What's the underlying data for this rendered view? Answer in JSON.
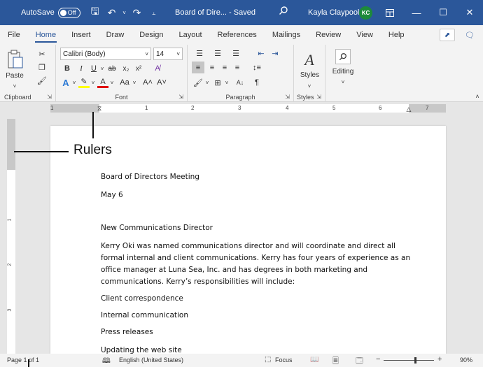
{
  "titlebar": {
    "autosave_label": "AutoSave",
    "autosave_state": "Off",
    "doc_title": "Board of Dire...  -  Saved",
    "user_name": "Kayla Claypool",
    "user_initials": "KC"
  },
  "tabs": [
    "File",
    "Home",
    "Insert",
    "Draw",
    "Design",
    "Layout",
    "References",
    "Mailings",
    "Review",
    "View",
    "Help"
  ],
  "ribbon": {
    "clipboard": {
      "paste_label": "Paste",
      "group_label": "Clipboard"
    },
    "font": {
      "font_name": "Calibri (Body)",
      "font_size": "14",
      "group_label": "Font",
      "bold": "B",
      "italic": "I",
      "underline": "U",
      "grow": "A˄",
      "shrink": "A˅",
      "case": "Aa"
    },
    "paragraph": {
      "group_label": "Paragraph"
    },
    "styles": {
      "styles_label": "Styles",
      "group_label": "Styles"
    },
    "editing": {
      "editing_label": "Editing"
    }
  },
  "ruler": {
    "numbers": [
      "1",
      "1",
      "2",
      "3",
      "4",
      "5",
      "6",
      "7"
    ],
    "vnumbers": [
      "1",
      "2",
      "3"
    ]
  },
  "document": {
    "lines": [
      "Board of Directors Meeting",
      "May 6",
      "New Communications Director",
      "Kerry Oki was named communications director and will coordinate and direct all",
      "formal internal and client communications. Kerry has four years of experience as an",
      "office manager at Luna Sea, Inc. and has degrees in both marketing and",
      "communications. Kerry’s responsibilities will include:",
      "Client correspondence",
      "Internal communication",
      "Press releases",
      "Updating the web site"
    ]
  },
  "annotation": {
    "label": "Rulers"
  },
  "statusbar": {
    "page": "Page 1 of 1",
    "language": "English (United States)",
    "focus": "Focus",
    "zoom_minus": "−",
    "zoom_plus": "+",
    "zoom": "90%"
  }
}
